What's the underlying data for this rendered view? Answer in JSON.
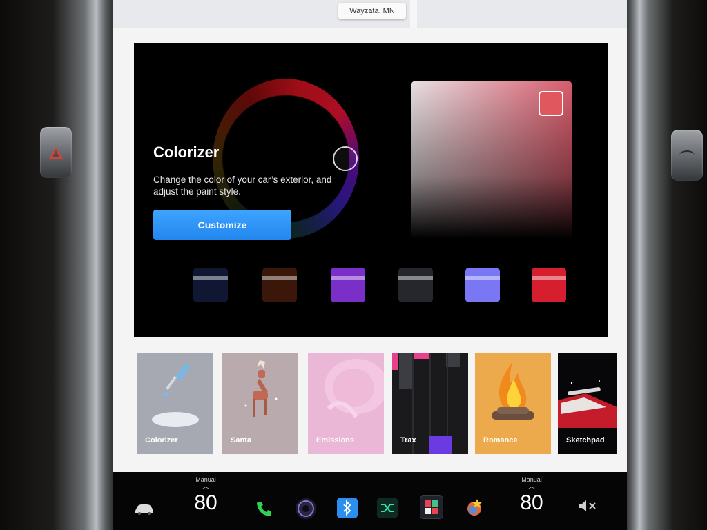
{
  "map": {
    "location": "Wayzata, MN"
  },
  "feature": {
    "title": "Colorizer",
    "description": "Change the color of your car’s exterior, and adjust the paint style.",
    "button_label": "Customize",
    "selected_color": "#e0575e",
    "swatches": [
      "#0f1733",
      "#3a1708",
      "#7a2fc8",
      "#26272c",
      "#7a77f4",
      "#d61f2e"
    ]
  },
  "apps": [
    {
      "label": "Colorizer",
      "color": "#a6a8b2"
    },
    {
      "label": "Santa",
      "color": "#b9aaae"
    },
    {
      "label": "Emissions",
      "color": "#eab7d6"
    },
    {
      "label": "Trax",
      "color": "#161616"
    },
    {
      "label": "Romance",
      "color": "#ecaa4c"
    },
    {
      "label": "Sketchpad",
      "color": "#070709"
    }
  ],
  "taskbar": {
    "left_temp": {
      "mode": "Manual",
      "value": "80"
    },
    "right_temp": {
      "mode": "Manual",
      "value": "80"
    },
    "icons": [
      "car-icon",
      "phone-icon",
      "camera-icon",
      "bluetooth-icon",
      "shuffle-icon",
      "toybox-icon",
      "apps-icon",
      "mute-icon"
    ]
  }
}
